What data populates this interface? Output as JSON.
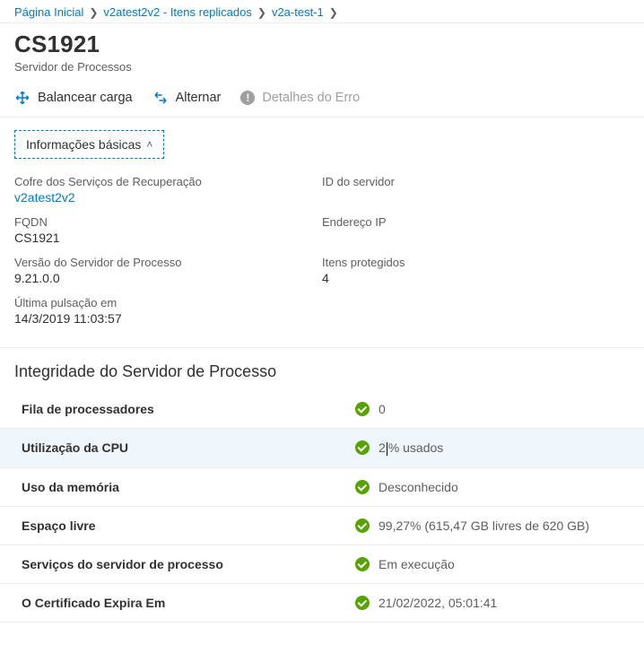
{
  "breadcrumb": {
    "home": "Página Inicial",
    "intermediate": "v2atest2v2 - Itens replicados",
    "tail": "v2a-test-1"
  },
  "header": {
    "title": "CS1921",
    "subtitle": "Servidor de Processos"
  },
  "toolbar": {
    "balance": "Balancear carga",
    "switch_": "Alternar",
    "error_details": "Detalhes do Erro"
  },
  "section_toggle": {
    "label": "Informações básicas"
  },
  "info": {
    "vault_label": "Cofre dos Serviços de Recuperação",
    "vault_value": "v2atest2v2",
    "server_id_label": "ID do servidor",
    "server_id_value": "",
    "fqdn_label": "FQDN",
    "fqdn_value": "CS1921",
    "ip_label": "Endereço IP",
    "ip_value": "",
    "version_label": "Versão do Servidor de Processo",
    "version_value": "9.21.0.0",
    "protected_label": "Itens protegidos",
    "protected_value": "4",
    "heartbeat_label": "Última pulsação em",
    "heartbeat_value": "14/3/2019 11:03:57"
  },
  "health": {
    "title": "Integridade do Servidor de Processo",
    "rows": [
      {
        "label": "Fila de processadores",
        "value": "0",
        "status": "ok"
      },
      {
        "label": "Utilização da CPU",
        "value_pre": "2",
        "value_post": "% usados",
        "status": "ok",
        "highlight": true,
        "caret": true
      },
      {
        "label": "Uso da memória",
        "value": "Desconhecido",
        "status": "ok"
      },
      {
        "label": "Espaço livre",
        "value": "99,27% (615,47 GB livres de 620 GB)",
        "status": "ok"
      },
      {
        "label": "Serviços do servidor de processo",
        "value": "Em execução",
        "status": "ok"
      },
      {
        "label": "O Certificado Expira Em",
        "value": "21/02/2022, 05:01:41",
        "status": "ok"
      }
    ]
  }
}
